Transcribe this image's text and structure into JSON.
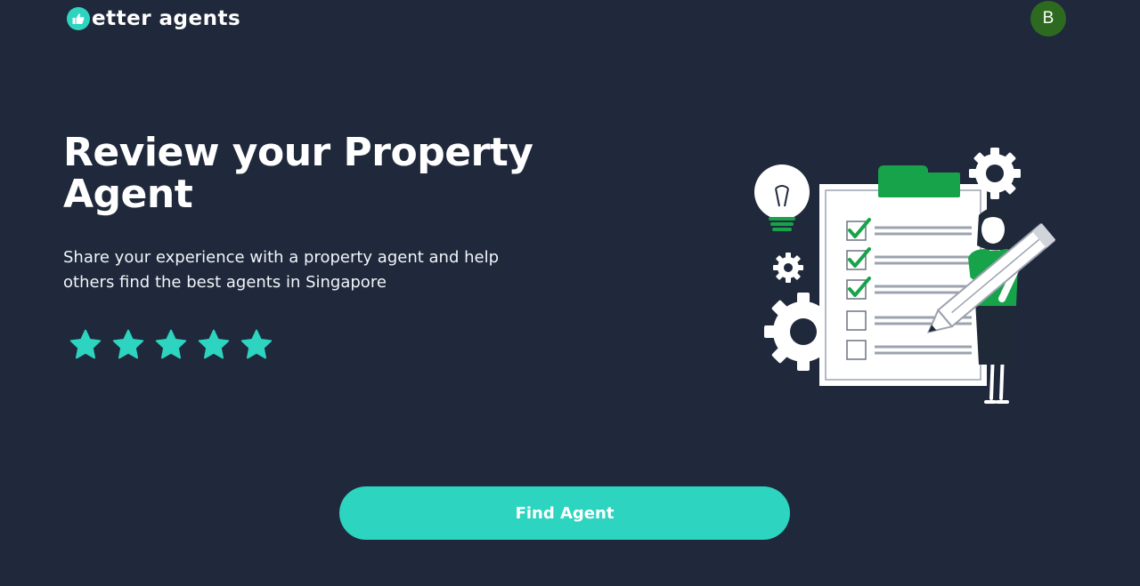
{
  "header": {
    "logo_text": "etter agents",
    "logo_icon": "thumbs-up-icon",
    "avatar_initial": "B"
  },
  "hero": {
    "title": "Review your Property Agent",
    "subtitle": "Share your experience with a property agent and help others find the best agents in Singapore",
    "rating_stars": 5
  },
  "illustration": {
    "icons": [
      "lightbulb-icon",
      "gear-icon",
      "clipboard-checklist-icon",
      "pencil-icon"
    ],
    "checklist": [
      true,
      true,
      true,
      false,
      false
    ]
  },
  "cta": {
    "find_agent_label": "Find Agent"
  },
  "colors": {
    "background": "#1f293b",
    "accent": "#2dd4bf",
    "avatar": "#2d6a1f",
    "illustration_green": "#16a34a"
  }
}
